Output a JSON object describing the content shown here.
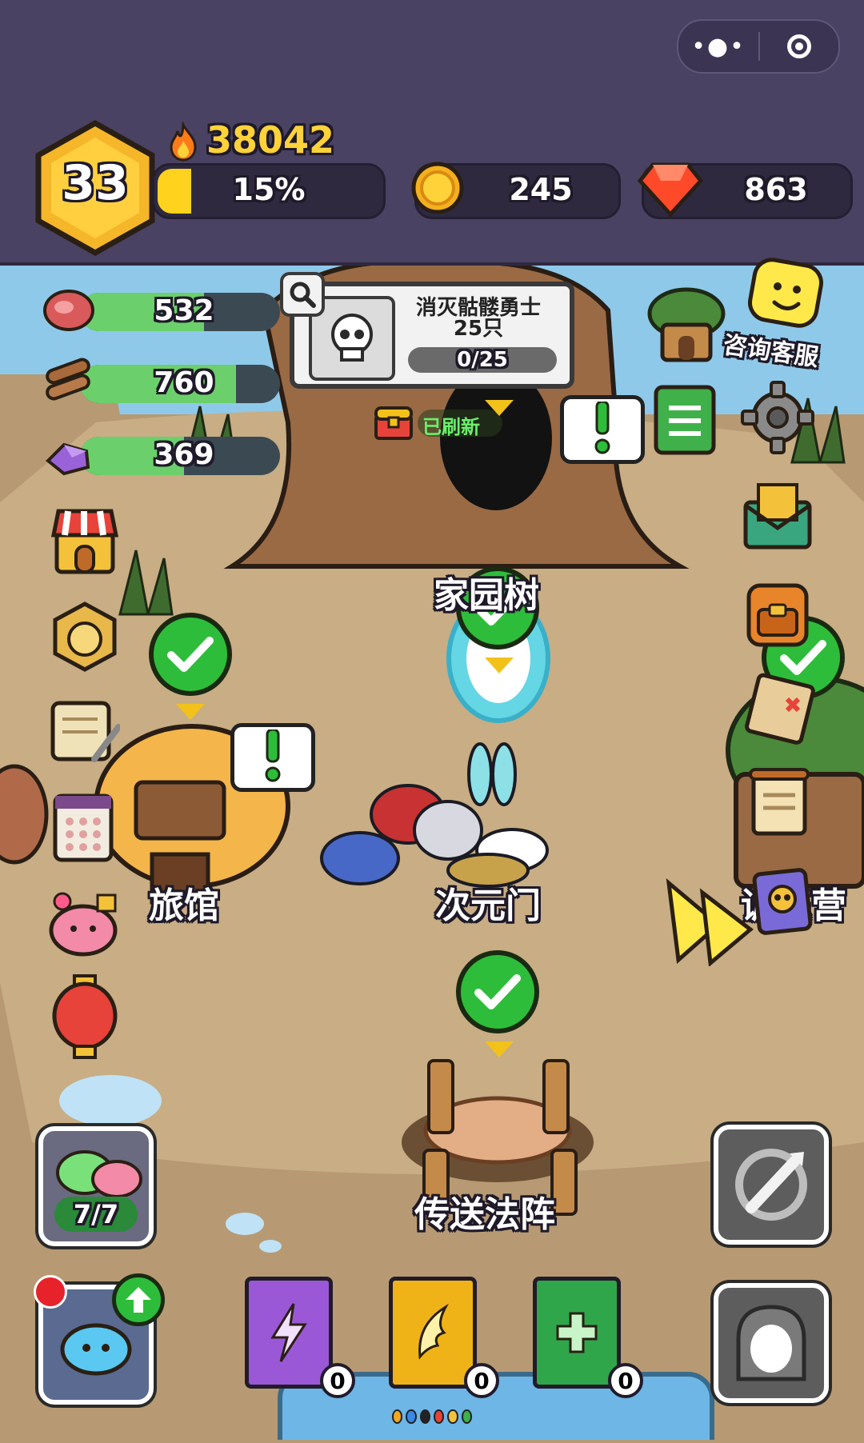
{
  "header": {
    "level": "33",
    "power": "38042",
    "exp_percent_label": "15%",
    "exp_progress": 0.15,
    "coins": "245",
    "gems": "863"
  },
  "resources": [
    {
      "icon": "meat-icon",
      "value": "532",
      "fill": 0.62
    },
    {
      "icon": "wood-icon",
      "value": "760",
      "fill": 0.78
    },
    {
      "icon": "crystal-ore-icon",
      "value": "369",
      "fill": 0.52
    }
  ],
  "quest": {
    "title_line1": "消灭骷髅勇士",
    "title_line2": "25只",
    "progress_text": "0/25",
    "progress": 0.0
  },
  "chest_status": "已刷新",
  "support": {
    "label": "咨询客服"
  },
  "buildings": {
    "home_tree": "家园树",
    "inn": "旅馆",
    "portal": "次元门",
    "camp": "训练营",
    "teleport": "传送法阵"
  },
  "team_counter": "7/7",
  "books": [
    {
      "icon": "lightning-book-icon",
      "count": "0",
      "color": "#9a58d6"
    },
    {
      "icon": "wing-book-icon",
      "count": "0",
      "color": "#f0b317"
    },
    {
      "icon": "plus-book-icon",
      "count": "0",
      "color": "#2fa64a"
    }
  ],
  "colors": {
    "topbar": "#4a4262",
    "gold": "#ffd23a",
    "check_green": "#2ebd3a",
    "gem_red": "#ff4a2a"
  }
}
